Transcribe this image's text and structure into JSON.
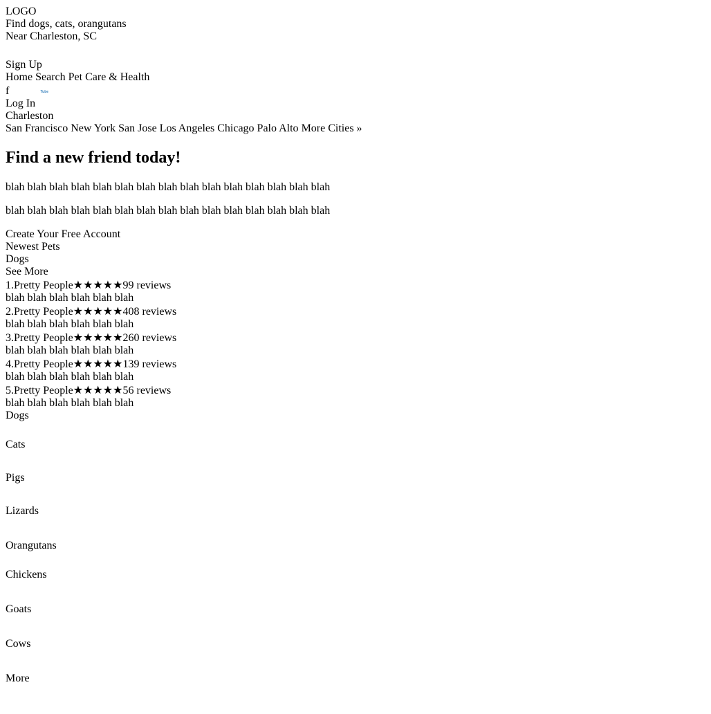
{
  "header": {
    "logo_text": "LOGO",
    "find_label": "Find",
    "find_value": "dogs, cats, orangutans",
    "near_label": "Near",
    "near_value": "Charleston, SC",
    "signup_label": "Sign Up",
    "login_label": "Log In",
    "nav": [
      "Home",
      "Search",
      "Pet Care & Health"
    ],
    "social_icons": [
      "facebook-icon",
      "twitter-icon",
      "pinterest-icon",
      "youtube-icon",
      "instagram-icon"
    ],
    "colors": {
      "bar": "#3a83be",
      "accent_red": "#c41200",
      "logo_green": "#3d9a3d"
    }
  },
  "city": {
    "current": "Charleston",
    "others": [
      "San Francisco",
      "New York",
      "San Jose",
      "Los Angeles",
      "Chicago",
      "Palo Alto",
      "More Cities »"
    ]
  },
  "promo": {
    "title": "Find a new friend today!",
    "body1": "blah blah blah blah blah blah blah blah blah blah blah blah blah blah blah",
    "body2": "blah blah blah blah blah blah blah blah blah blah blah blah blah blah blah",
    "cta": "Create Your Free Account"
  },
  "newest": {
    "heading": "Newest Pets",
    "category": "Dogs",
    "see_more": "See More",
    "items": [
      {
        "num": "1.",
        "name": "Pretty People",
        "reviews": "99 reviews",
        "rating": 5,
        "text": "blah blah blah blah blah blah"
      },
      {
        "num": "2.",
        "name": "Pretty People",
        "reviews": "408 reviews",
        "rating": 4.5,
        "text": "blah blah blah blah blah blah"
      },
      {
        "num": "3.",
        "name": "Pretty People",
        "reviews": "260 reviews",
        "rating": 4.5,
        "text": "blah blah blah blah blah blah"
      },
      {
        "num": "4.",
        "name": "Pretty People",
        "reviews": "139 reviews",
        "rating": 4.5,
        "text": "blah blah blah blah blah blah"
      },
      {
        "num": "5.",
        "name": "Pretty People",
        "reviews": "56 reviews",
        "rating": 4.5,
        "text": "blah blah blah blah blah blah"
      }
    ]
  },
  "categories": [
    "Dogs",
    "Cats",
    "Pigs",
    "Lizards",
    "Orangutans",
    "Chickens",
    "Goats",
    "Cows",
    "More"
  ]
}
